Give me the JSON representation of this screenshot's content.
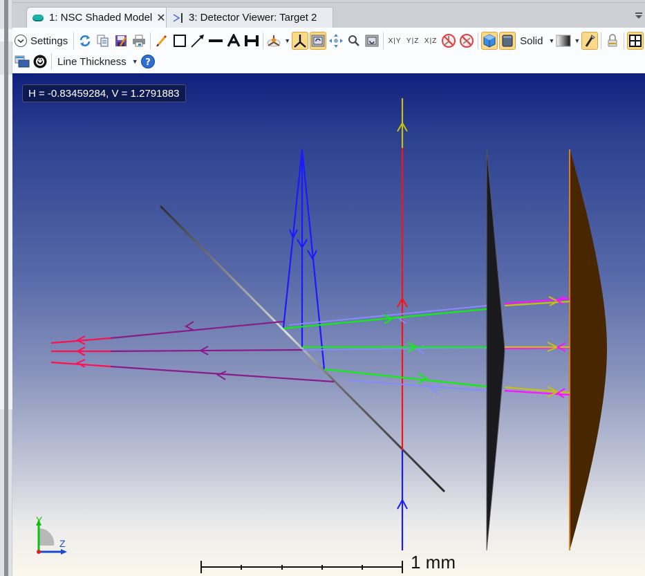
{
  "tabs": [
    {
      "label": "1: NSC Shaded Model",
      "active": true,
      "icon": "nsc-shaded-model-icon",
      "closable": true
    },
    {
      "label": "3: Detector Viewer: Target 2",
      "active": false,
      "icon": "detector-viewer-icon"
    }
  ],
  "toolbar": {
    "settings_label": "Settings",
    "line_thickness_label": "Line Thickness",
    "render_mode_label": "Solid",
    "axis_xy": "X|Y",
    "axis_yz": "Y|Z",
    "axis_xz": "X|Z",
    "icons_row1": [
      "settings-chevron-icon",
      "refresh-icon",
      "copy-icon",
      "save-icon",
      "print-icon",
      "pencil-icon",
      "rectangle-icon",
      "arrow-icon",
      "line-icon",
      "text-icon",
      "dimension-icon",
      "rotate-axes-icon",
      "axes-icon",
      "rotate-view-icon",
      "pan-icon",
      "zoom-icon",
      "reset-view-icon",
      "hide-rays-icon",
      "hide-lens-icon",
      "cube-icon",
      "square-icon",
      "gradient-icon",
      "flashlight-icon",
      "lock-icon",
      "fit-window-icon"
    ],
    "icons_row2": [
      "window-layout-icon",
      "update-icon",
      "help-icon"
    ]
  },
  "viewport": {
    "coordinate_readout": "H = -0.83459284, V = 1.2791883",
    "scale_bar_label": "1 mm",
    "axis_labels": {
      "y": "Y",
      "z": "Z"
    },
    "colors": {
      "ray_blue": "#1a1aff",
      "ray_red": "#ff1010",
      "ray_green": "#10ee10",
      "ray_yellow": "#c8c010",
      "ray_purple": "#8a1a8a",
      "ray_crimson": "#ff1050",
      "ray_lightblue": "#8888ff",
      "ray_magenta": "#ff10ff",
      "lens_dark": "#1a1a1e",
      "lens_brown": "#482600"
    }
  }
}
